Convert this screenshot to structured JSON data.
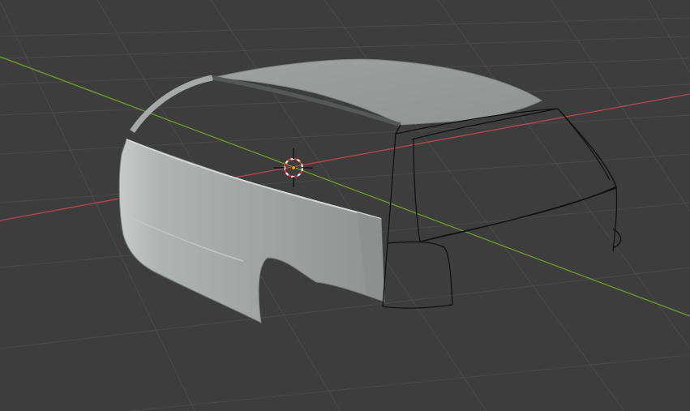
{
  "viewport": {
    "background_color": "#3d3d3d",
    "grid_line_color": "#4c4c4c",
    "x_axis_color": "#b8464f",
    "y_axis_color": "#6f9a2c",
    "mesh_shaded_color": "#a3a7a6",
    "mesh_wire_color": "#111111",
    "cursor_ring_colors": [
      "#d83131",
      "#f0f0f0"
    ],
    "origin_dot_color": "#f6a200"
  },
  "scene": {
    "objects": [
      "car-body-mesh"
    ],
    "tool": "3d-cursor"
  }
}
